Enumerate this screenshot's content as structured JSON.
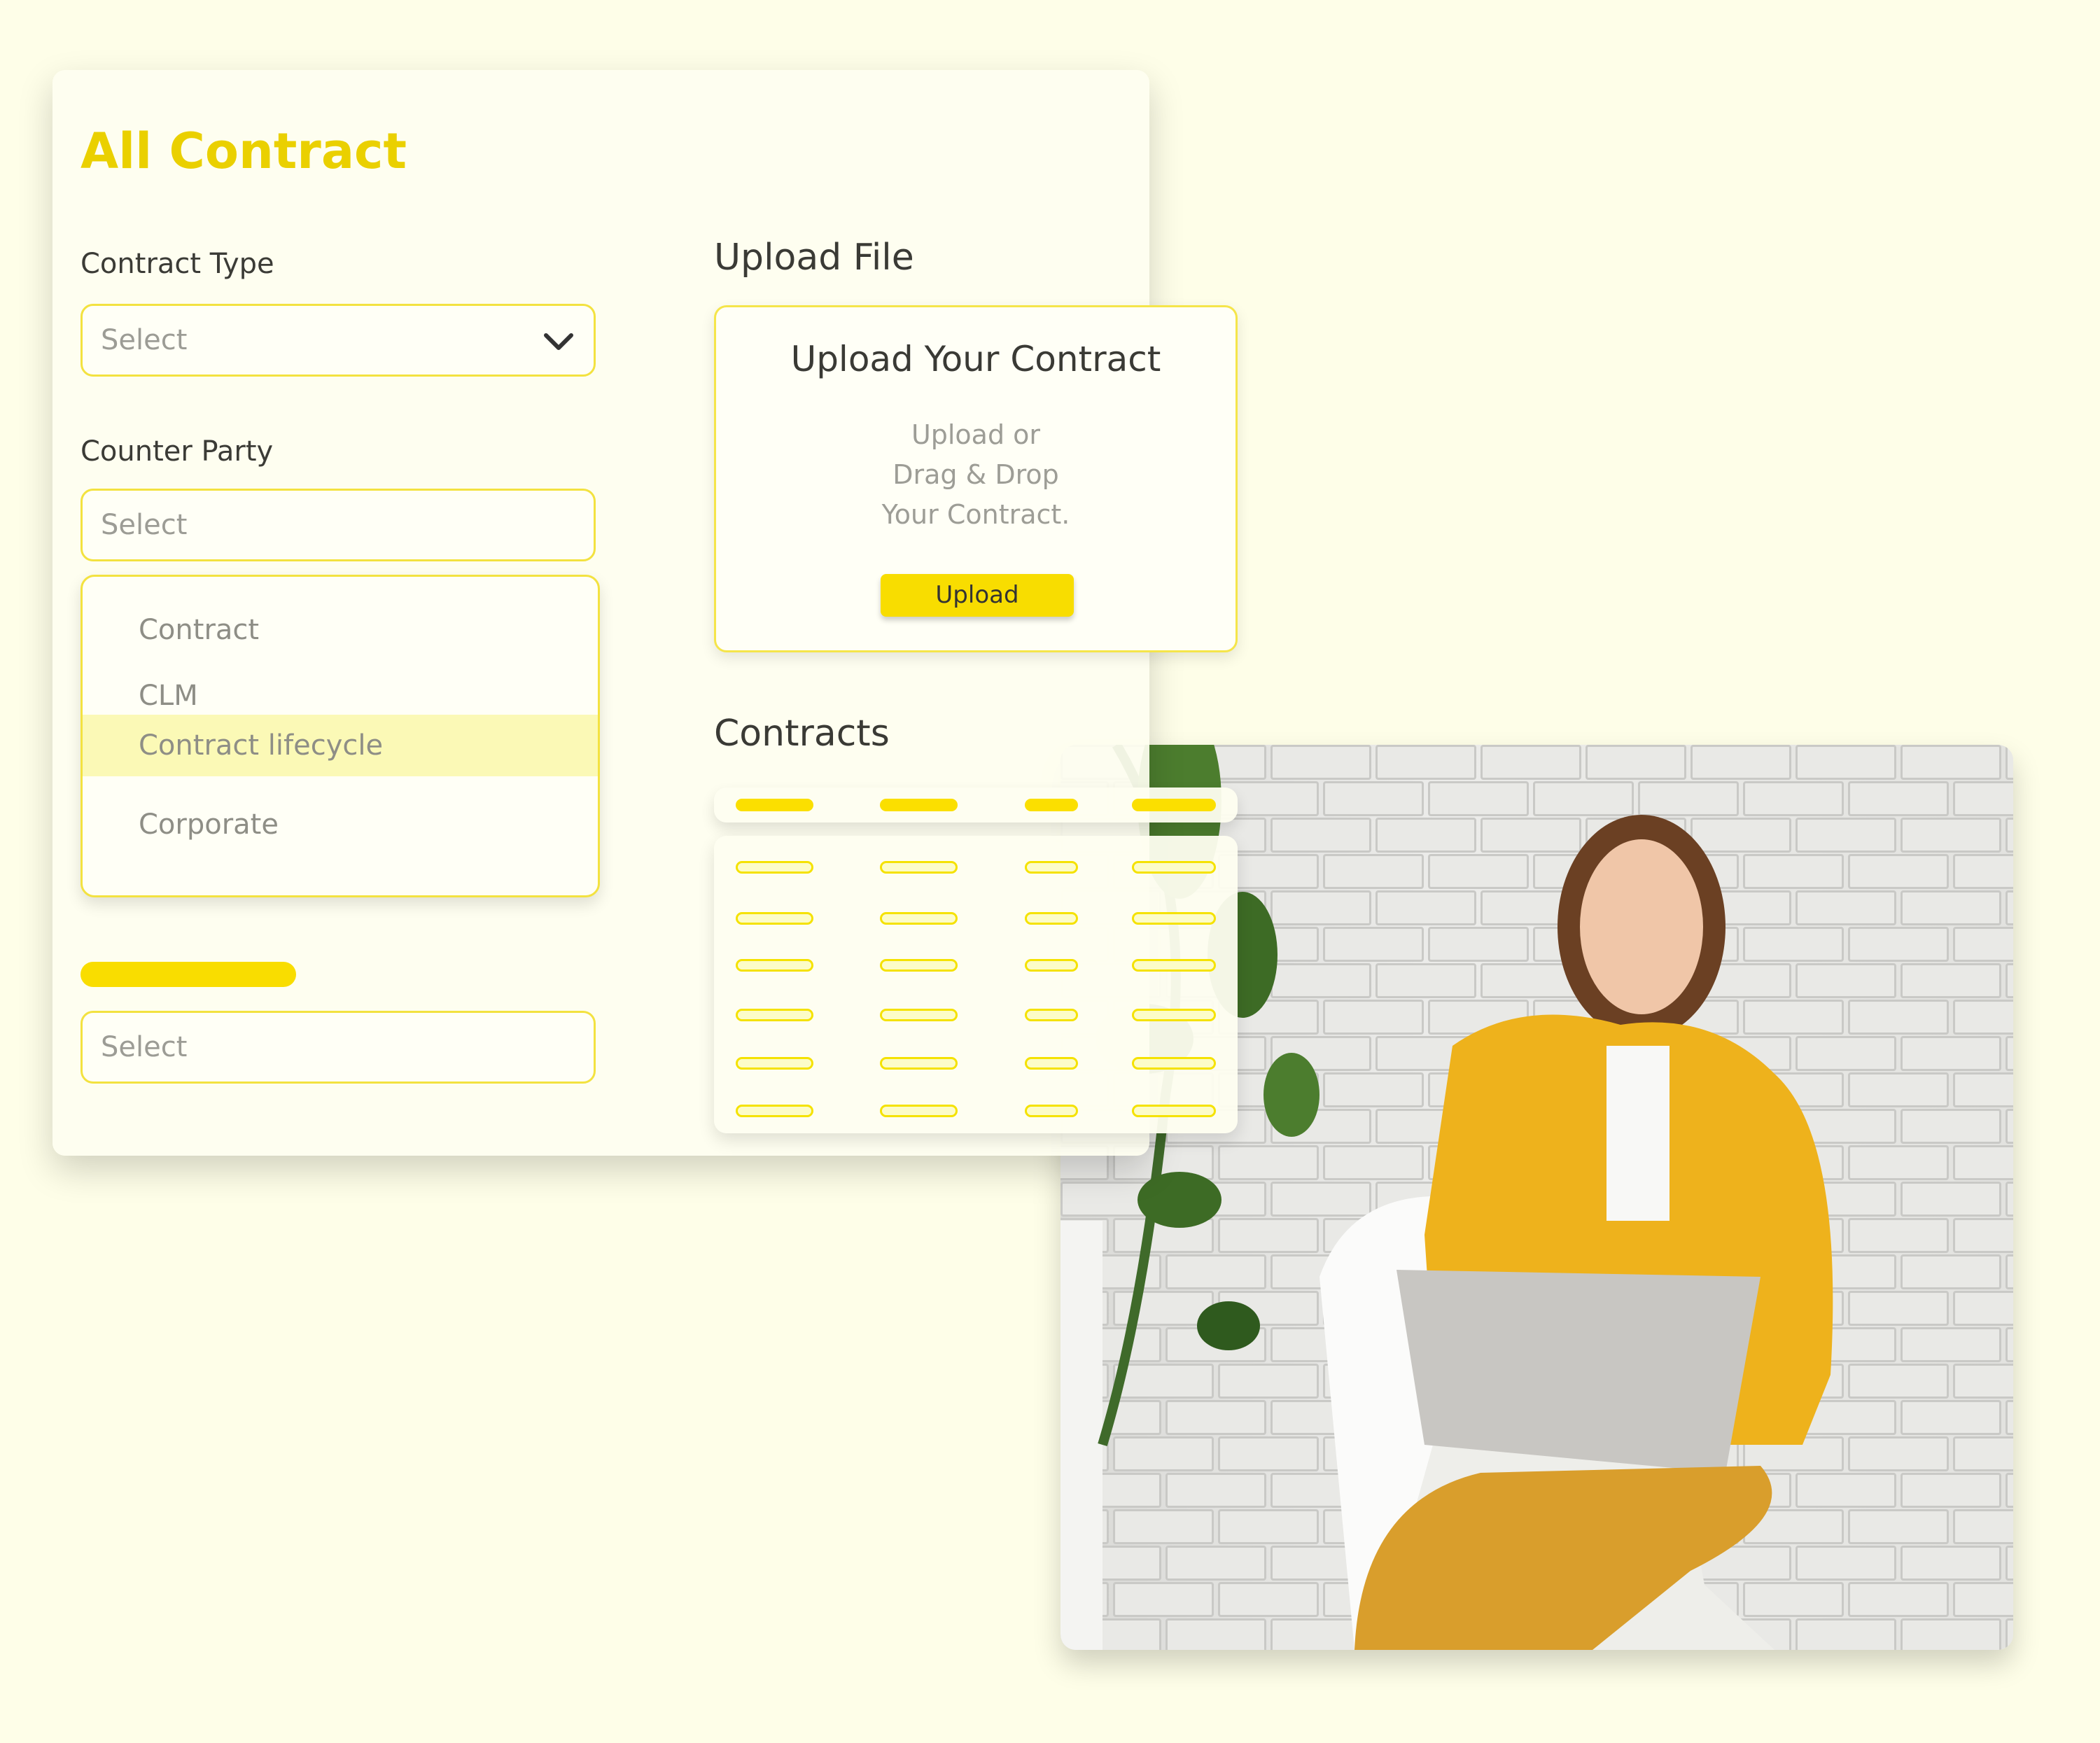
{
  "card": {
    "title": "All Contract",
    "contract_type": {
      "label": "Contract Type",
      "placeholder": "Select"
    },
    "counter_party": {
      "label": "Counter Party",
      "placeholder": "Select"
    },
    "dropdown_options": [
      "Contract",
      "CLM",
      "Contract lifecycle",
      "Corporate"
    ],
    "highlighted_option": "Contract lifecycle",
    "third_select": {
      "placeholder": "Select"
    },
    "upload": {
      "section_label": "Upload File",
      "heading": "Upload Your Contract",
      "lines": [
        "Upload or",
        "Drag & Drop",
        "Your Contract."
      ],
      "button": "Upload"
    },
    "contracts_label": "Contracts"
  },
  "colors": {
    "accent": "#f9dd00",
    "title": "#ead000",
    "background": "#fefee8",
    "border": "#f3e240"
  },
  "icons": {
    "select_chevron": "chevron-down-icon"
  }
}
